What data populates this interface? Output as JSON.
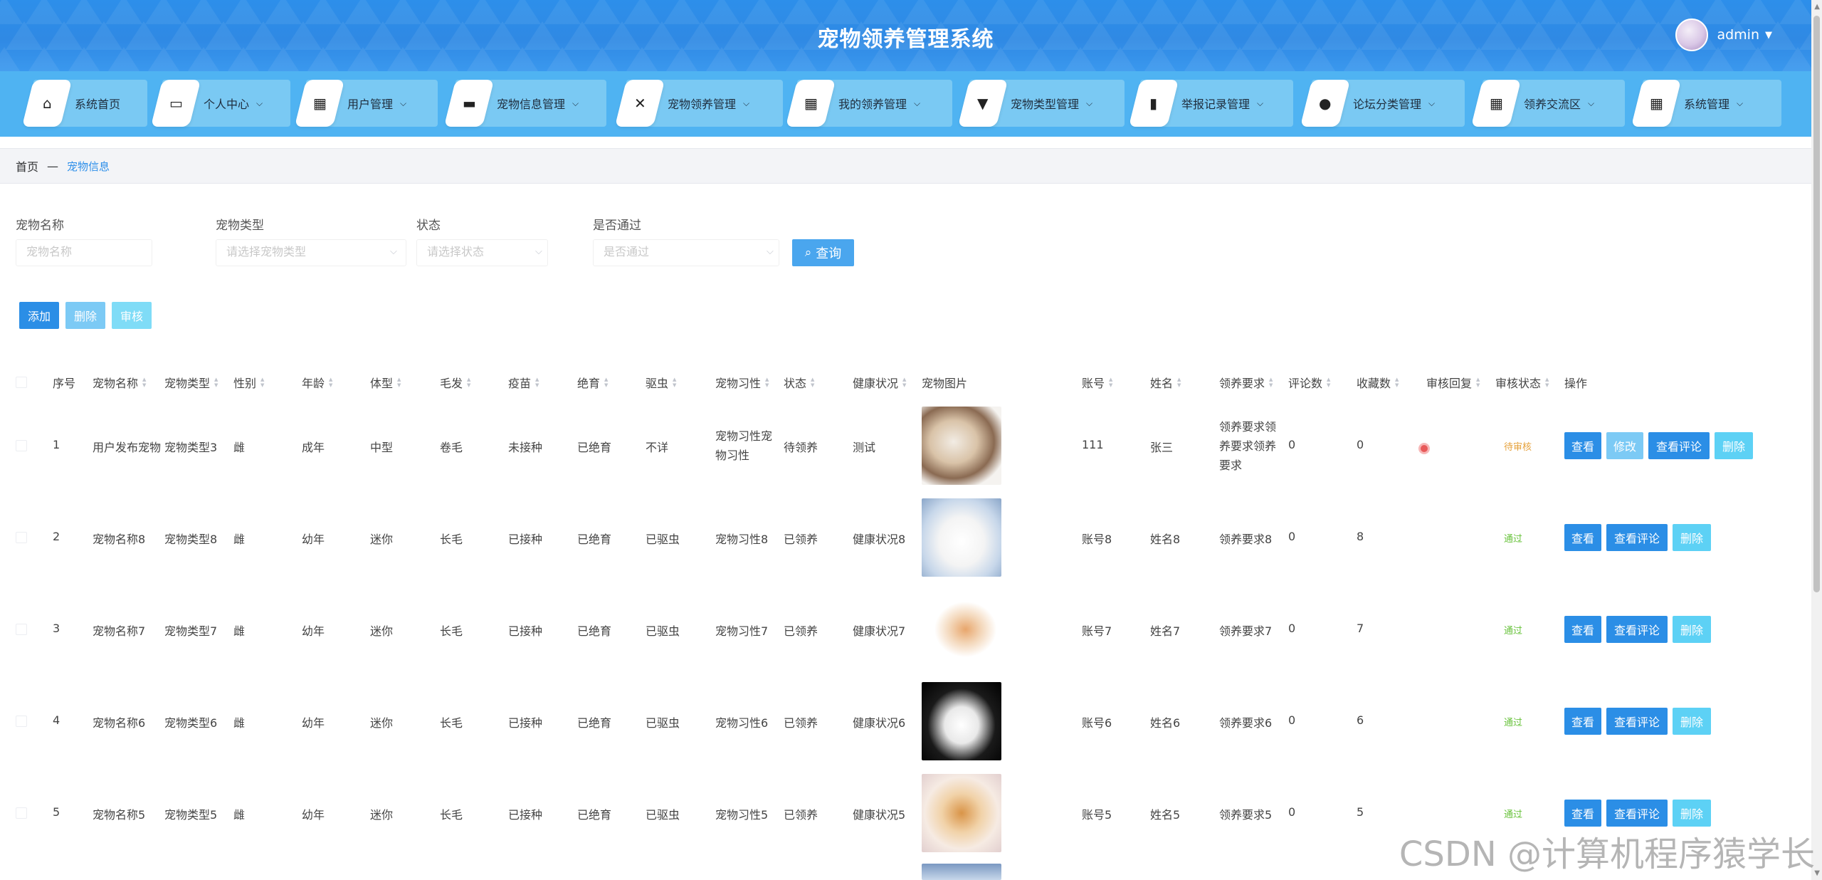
{
  "header": {
    "title": "宠物领养管理系统",
    "username": "admin"
  },
  "nav": [
    {
      "label": "系统首页",
      "icon": "home-icon",
      "glyph": "⌂",
      "dropdown": false
    },
    {
      "label": "个人中心",
      "icon": "card-icon",
      "glyph": "▭",
      "dropdown": true
    },
    {
      "label": "用户管理",
      "icon": "grid-icon",
      "glyph": "▦",
      "dropdown": true
    },
    {
      "label": "宠物信息管理",
      "icon": "monitor-icon",
      "glyph": "▬",
      "dropdown": true
    },
    {
      "label": "宠物领养管理",
      "icon": "ticket-icon",
      "glyph": "✕",
      "dropdown": true
    },
    {
      "label": "我的领养管理",
      "icon": "grid-icon",
      "glyph": "▦",
      "dropdown": true
    },
    {
      "label": "宠物类型管理",
      "icon": "pin-icon",
      "glyph": "▼",
      "dropdown": true
    },
    {
      "label": "举报记录管理",
      "icon": "chart-icon",
      "glyph": "▮",
      "dropdown": true
    },
    {
      "label": "论坛分类管理",
      "icon": "location-icon",
      "glyph": "●",
      "dropdown": true
    },
    {
      "label": "领养交流区",
      "icon": "grid-icon",
      "glyph": "▦",
      "dropdown": true
    },
    {
      "label": "系统管理",
      "icon": "grid-icon",
      "glyph": "▦",
      "dropdown": true
    }
  ],
  "breadcrumb": {
    "home": "首页",
    "separator": "—",
    "current": "宠物信息"
  },
  "search": {
    "name_label": "宠物名称",
    "name_placeholder": "宠物名称",
    "type_label": "宠物类型",
    "type_placeholder": "请选择宠物类型",
    "status_label": "状态",
    "status_placeholder": "请选择状态",
    "pass_label": "是否通过",
    "pass_placeholder": "是否通过",
    "query_label": "查询"
  },
  "actions": {
    "add": "添加",
    "delete": "删除",
    "audit": "审核"
  },
  "columns": [
    "序号",
    "宠物名称",
    "宠物类型",
    "性别",
    "年龄",
    "体型",
    "毛发",
    "疫苗",
    "绝育",
    "驱虫",
    "宠物习性",
    "状态",
    "健康状况",
    "宠物图片",
    "账号",
    "姓名",
    "领养要求",
    "评论数",
    "收藏数",
    "审核回复",
    "审核状态",
    "操作"
  ],
  "rows": [
    {
      "index": "1",
      "name": "用户发布宠物",
      "type": "宠物类型3",
      "gender": "雌",
      "age": "成年",
      "size": "中型",
      "fur": "卷毛",
      "vaccine": "未接种",
      "neuter": "已绝育",
      "deworm": "不详",
      "habit": "宠物习性宠物习性",
      "status": "待领养",
      "health": "测试",
      "account": "111",
      "realname": "张三",
      "requirement": "领养要求领养要求领养要求",
      "comments": "0",
      "favorites": "0",
      "reply": "",
      "audit": "待审核",
      "img": "cat-ragdoll"
    },
    {
      "index": "2",
      "name": "宠物名称8",
      "type": "宠物类型8",
      "gender": "雌",
      "age": "幼年",
      "size": "迷你",
      "fur": "长毛",
      "vaccine": "已接种",
      "neuter": "已绝育",
      "deworm": "已驱虫",
      "habit": "宠物习性8",
      "status": "已领养",
      "health": "健康状况8",
      "account": "账号8",
      "realname": "姓名8",
      "requirement": "领养要求8",
      "comments": "0",
      "favorites": "8",
      "reply": "",
      "audit": "通过",
      "img": "pomeranian"
    },
    {
      "index": "3",
      "name": "宠物名称7",
      "type": "宠物类型7",
      "gender": "雌",
      "age": "幼年",
      "size": "迷你",
      "fur": "长毛",
      "vaccine": "已接种",
      "neuter": "已绝育",
      "deworm": "已驱虫",
      "habit": "宠物习性7",
      "status": "已领养",
      "health": "健康状况7",
      "account": "账号7",
      "realname": "姓名7",
      "requirement": "领养要求7",
      "comments": "0",
      "favorites": "7",
      "reply": "",
      "audit": "通过",
      "img": "rabbit"
    },
    {
      "index": "4",
      "name": "宠物名称6",
      "type": "宠物类型6",
      "gender": "雌",
      "age": "幼年",
      "size": "迷你",
      "fur": "长毛",
      "vaccine": "已接种",
      "neuter": "已绝育",
      "deworm": "已驱虫",
      "habit": "宠物习性6",
      "status": "已领养",
      "health": "健康状况6",
      "account": "账号6",
      "realname": "姓名6",
      "requirement": "领养要求6",
      "comments": "0",
      "favorites": "6",
      "reply": "",
      "audit": "通过",
      "img": "white-cat"
    },
    {
      "index": "5",
      "name": "宠物名称5",
      "type": "宠物类型5",
      "gender": "雌",
      "age": "幼年",
      "size": "迷你",
      "fur": "长毛",
      "vaccine": "已接种",
      "neuter": "已绝育",
      "deworm": "已驱虫",
      "habit": "宠物习性5",
      "status": "已领养",
      "health": "健康状况5",
      "account": "账号5",
      "realname": "姓名5",
      "requirement": "领养要求5",
      "comments": "0",
      "favorites": "5",
      "reply": "",
      "audit": "通过",
      "img": "shiba"
    }
  ],
  "row_actions": {
    "view": "查看",
    "edit": "修改",
    "view_comments": "查看评论",
    "delete": "删除"
  },
  "colors": {
    "primary": "#2d8fea",
    "nav_bg": "#4fb3f2",
    "btn_blue": "#2b8ee6",
    "btn_light": "#63c2f3",
    "btn_cyan": "#5dd1f5",
    "pass_green": "#67c23a",
    "pending_orange": "#e6a23c"
  },
  "watermark": "CSDN @计算机程序猿学长"
}
